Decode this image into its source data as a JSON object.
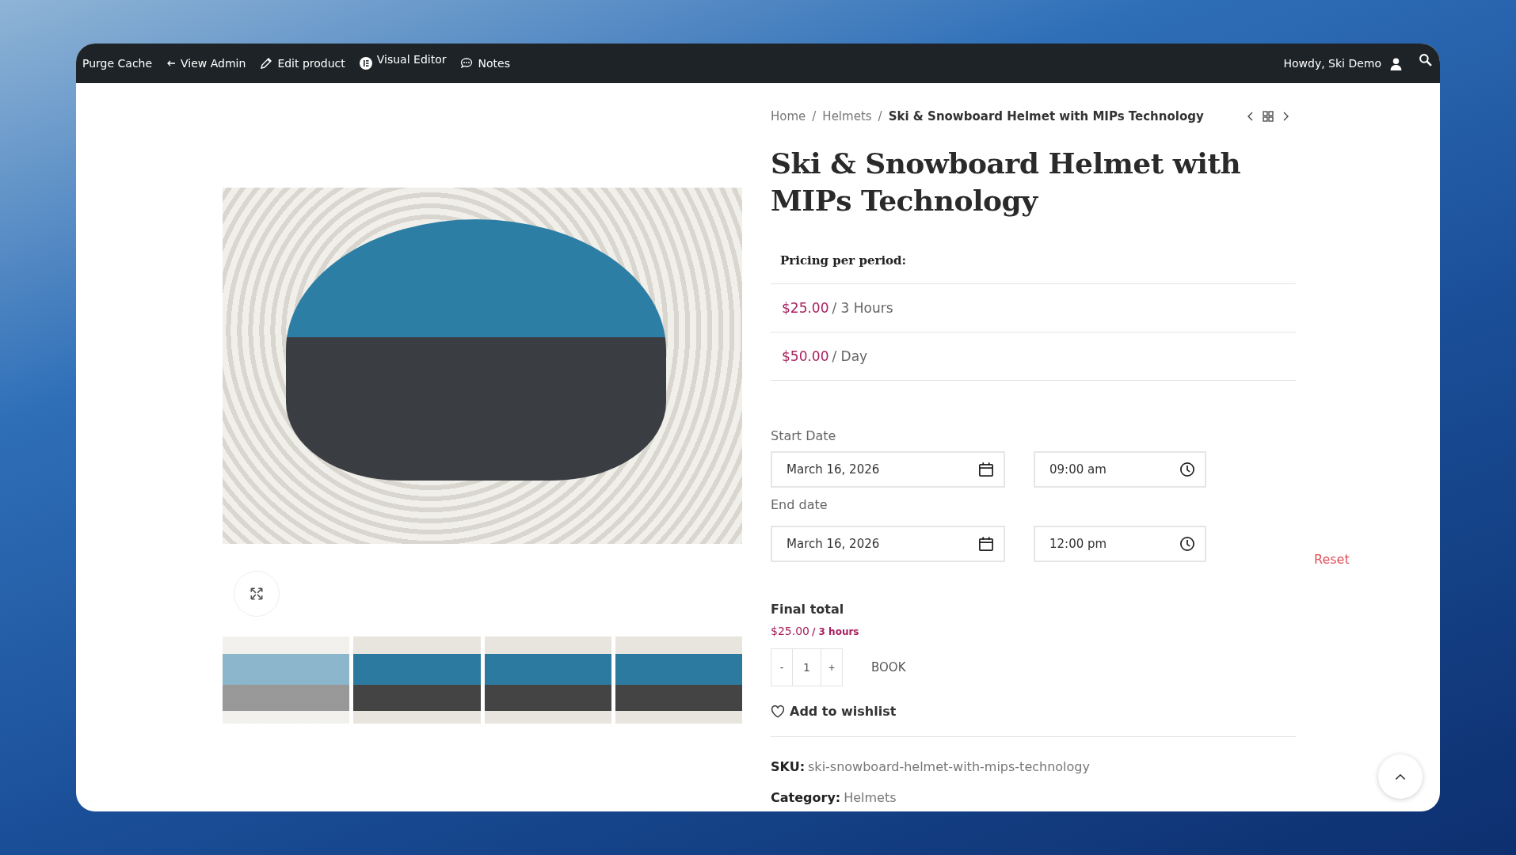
{
  "toolbar": {
    "items": [
      {
        "kind": "plain",
        "label": "Purge Cache"
      },
      {
        "kind": "back",
        "label": "View Admin"
      },
      {
        "kind": "edit",
        "label": "Edit product"
      },
      {
        "kind": "editor",
        "label": "Visual Editor"
      },
      {
        "kind": "notes",
        "label": "Notes"
      }
    ],
    "greeting": "Howdy, Ski Demo"
  },
  "gallery": {
    "thumbnails": [
      {
        "selected": true
      },
      {
        "selected": false
      },
      {
        "selected": false
      },
      {
        "selected": false
      }
    ]
  },
  "breadcrumb": [
    {
      "label": "Home",
      "current": false
    },
    {
      "separator": "/",
      "label": "Helmets",
      "current": false
    },
    {
      "separator": "/",
      "label": "Ski & Snowboard Helmet with MIPs Technology",
      "current": true
    }
  ],
  "product": {
    "title": "Ski & Snowboard Helmet with MIPs Technology",
    "pricing_heading": "Pricing per period:",
    "pricing": [
      {
        "price": "$25.00",
        "period": "/ 3 Hours"
      },
      {
        "price": "$50.00",
        "period": "/ Day"
      }
    ]
  },
  "booking": {
    "start_label": "Start Date",
    "start_date": "March 16, 2026",
    "start_time": "09:00 am",
    "end_label": "End date",
    "end_date": "March 16, 2026",
    "end_time": "12:00 pm",
    "reset": "Reset",
    "total_label": "Final total",
    "total_price": "$25.00",
    "total_period": "/ 3 hours",
    "minus": "-",
    "quantity": "1",
    "plus": "+",
    "book": "BOOK",
    "wishlist": "Add to wishlist"
  },
  "meta": [
    {
      "label": "SKU:",
      "value": "ski-snowboard-helmet-with-mips-technology"
    },
    {
      "label": "Category:",
      "value": "Helmets"
    }
  ]
}
